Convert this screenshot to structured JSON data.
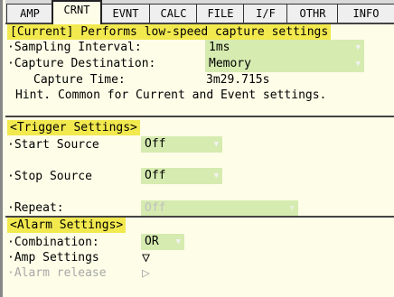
{
  "tabs": [
    "AMP",
    "CRNT",
    "EVNT",
    "CALC",
    "FILE",
    "I/F",
    "OTHR",
    "INFO"
  ],
  "current_section": {
    "heading": "[Current] Performs low-speed capture settings",
    "sampling_interval": {
      "label": "·Sampling Interval:",
      "value": "1ms"
    },
    "capture_destination": {
      "label": "·Capture Destination:",
      "value": "Memory"
    },
    "capture_time": {
      "label": "Capture Time:",
      "value": "3m29.715s"
    },
    "hint": "Hint. Common for Current and Event settings."
  },
  "trigger_section": {
    "heading": "<Trigger Settings>",
    "start_source": {
      "label": "·Start Source",
      "value": "Off"
    },
    "stop_source": {
      "label": "·Stop Source",
      "value": "Off"
    },
    "repeat": {
      "label": "·Repeat:",
      "value": "Off"
    }
  },
  "alarm_section": {
    "heading": "<Alarm Settings>",
    "combination": {
      "label": "·Combination:",
      "value": "OR"
    },
    "amp_settings": {
      "label": "·Amp Settings"
    },
    "alarm_release": {
      "label": "·Alarm release"
    }
  },
  "icons": {
    "dropdown": "dropdown-arrow-icon",
    "expand": "triangle-down-icon",
    "go": "triangle-right-icon"
  }
}
